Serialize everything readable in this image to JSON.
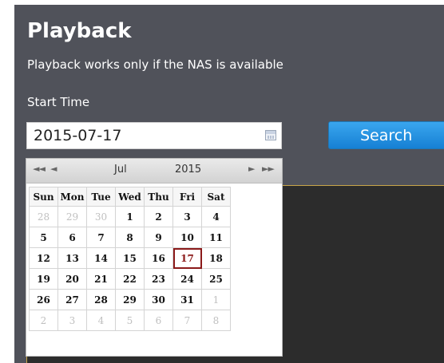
{
  "page": {
    "title": "Playback",
    "subtitle": "Playback works only if the NAS is available",
    "start_time_label": "Start Time",
    "start_time_value": "2015-07-17",
    "search_label": "Search"
  },
  "calendar": {
    "nav_prev_year": "◄◄",
    "nav_prev_month": "◄",
    "nav_next_month": "►",
    "nav_next_year": "►►",
    "month": "Jul",
    "year": "2015",
    "weekdays": [
      "Sun",
      "Mon",
      "Tue",
      "Wed",
      "Thu",
      "Fri",
      "Sat"
    ],
    "weeks": [
      [
        {
          "d": "28",
          "o": true
        },
        {
          "d": "29",
          "o": true
        },
        {
          "d": "30",
          "o": true
        },
        {
          "d": "1"
        },
        {
          "d": "2"
        },
        {
          "d": "3"
        },
        {
          "d": "4"
        }
      ],
      [
        {
          "d": "5"
        },
        {
          "d": "6"
        },
        {
          "d": "7"
        },
        {
          "d": "8"
        },
        {
          "d": "9"
        },
        {
          "d": "10"
        },
        {
          "d": "11"
        }
      ],
      [
        {
          "d": "12"
        },
        {
          "d": "13"
        },
        {
          "d": "14"
        },
        {
          "d": "15"
        },
        {
          "d": "16"
        },
        {
          "d": "17",
          "s": true
        },
        {
          "d": "18"
        }
      ],
      [
        {
          "d": "19"
        },
        {
          "d": "20"
        },
        {
          "d": "21"
        },
        {
          "d": "22"
        },
        {
          "d": "23"
        },
        {
          "d": "24"
        },
        {
          "d": "25"
        }
      ],
      [
        {
          "d": "26"
        },
        {
          "d": "27"
        },
        {
          "d": "28"
        },
        {
          "d": "29"
        },
        {
          "d": "30"
        },
        {
          "d": "31"
        },
        {
          "d": "1",
          "o": true
        }
      ],
      [
        {
          "d": "2",
          "o": true
        },
        {
          "d": "3",
          "o": true
        },
        {
          "d": "4",
          "o": true
        },
        {
          "d": "5",
          "o": true
        },
        {
          "d": "6",
          "o": true
        },
        {
          "d": "7",
          "o": true
        },
        {
          "d": "8",
          "o": true
        }
      ]
    ]
  },
  "colors": {
    "panel_bg": "#50525a",
    "video_bg": "#2c2c2c",
    "accent_border": "#c9a54a",
    "button_blue": "#1680d4",
    "selected_day": "#8b1a1a"
  }
}
